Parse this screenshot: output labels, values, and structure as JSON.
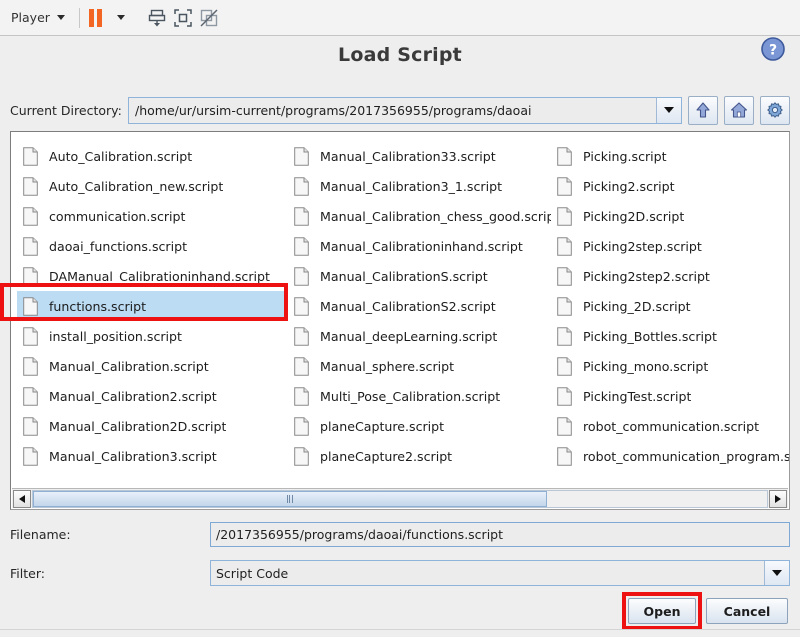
{
  "toolbar": {
    "player_label": "Player",
    "icons": [
      {
        "name": "player-dropdown-caret",
        "glyph": "chevron-down-icon"
      },
      {
        "name": "pause-button",
        "glyph": "pause-icon"
      },
      {
        "name": "pause-dropdown-caret",
        "glyph": "chevron-down-icon"
      },
      {
        "name": "dock-window-button",
        "glyph": "dock-down-icon"
      },
      {
        "name": "fullscreen-button",
        "glyph": "fullscreen-icon"
      },
      {
        "name": "disable-overlay-button",
        "glyph": "no-overlay-icon"
      }
    ]
  },
  "dialog": {
    "title": "Load Script",
    "help_icon": "help-question-icon"
  },
  "directory": {
    "label": "Current Directory:",
    "value": "/home/ur/ursim-current/programs/2017356955/programs/daoai",
    "dropdown_icon": "chevron-down-icon",
    "buttons": [
      {
        "name": "parent-directory-button",
        "icon": "up-arrow-icon"
      },
      {
        "name": "home-directory-button",
        "icon": "home-icon"
      },
      {
        "name": "settings-button",
        "icon": "gear-icon"
      }
    ]
  },
  "file_list": {
    "selected": "functions.script",
    "columns": [
      [
        "Auto_Calibration.script",
        "Auto_Calibration_new.script",
        "communication.script",
        "daoai_functions.script",
        "DAManual_Calibrationinhand.script",
        "functions.script",
        "install_position.script",
        "Manual_Calibration.script",
        "Manual_Calibration2.script",
        "Manual_Calibration2D.script",
        "Manual_Calibration3.script"
      ],
      [
        "Manual_Calibration33.script",
        "Manual_Calibration3_1.script",
        "Manual_Calibration_chess_good.script",
        "Manual_Calibrationinhand.script",
        "Manual_CalibrationS.script",
        "Manual_CalibrationS2.script",
        "Manual_deepLearning.script",
        "Manual_sphere.script",
        "Multi_Pose_Calibration.script",
        "planeCapture.script",
        "planeCapture2.script"
      ],
      [
        "Picking.script",
        "Picking2.script",
        "Picking2D.script",
        "Picking2step.script",
        "Picking2step2.script",
        "Picking_2D.script",
        "Picking_Bottles.script",
        "Picking_mono.script",
        "PickingTest.script",
        "robot_communication.script",
        "robot_communication_program.s"
      ]
    ],
    "scrollbar": {
      "left_arrow": "triangle-left-icon",
      "right_arrow": "triangle-right-icon",
      "thumb_position_percent": 0
    }
  },
  "filename": {
    "label": "Filename:",
    "value": "/2017356955/programs/daoai/functions.script"
  },
  "filter": {
    "label": "Filter:",
    "value": "Script Code",
    "dropdown_icon": "chevron-down-icon"
  },
  "footer": {
    "open_label": "Open",
    "cancel_label": "Cancel"
  },
  "colors": {
    "accent_orange": "#f26522",
    "selection_blue": "#bcdcf4",
    "annotation_red": "#ee1111",
    "window_bg": "#eeeeee"
  }
}
